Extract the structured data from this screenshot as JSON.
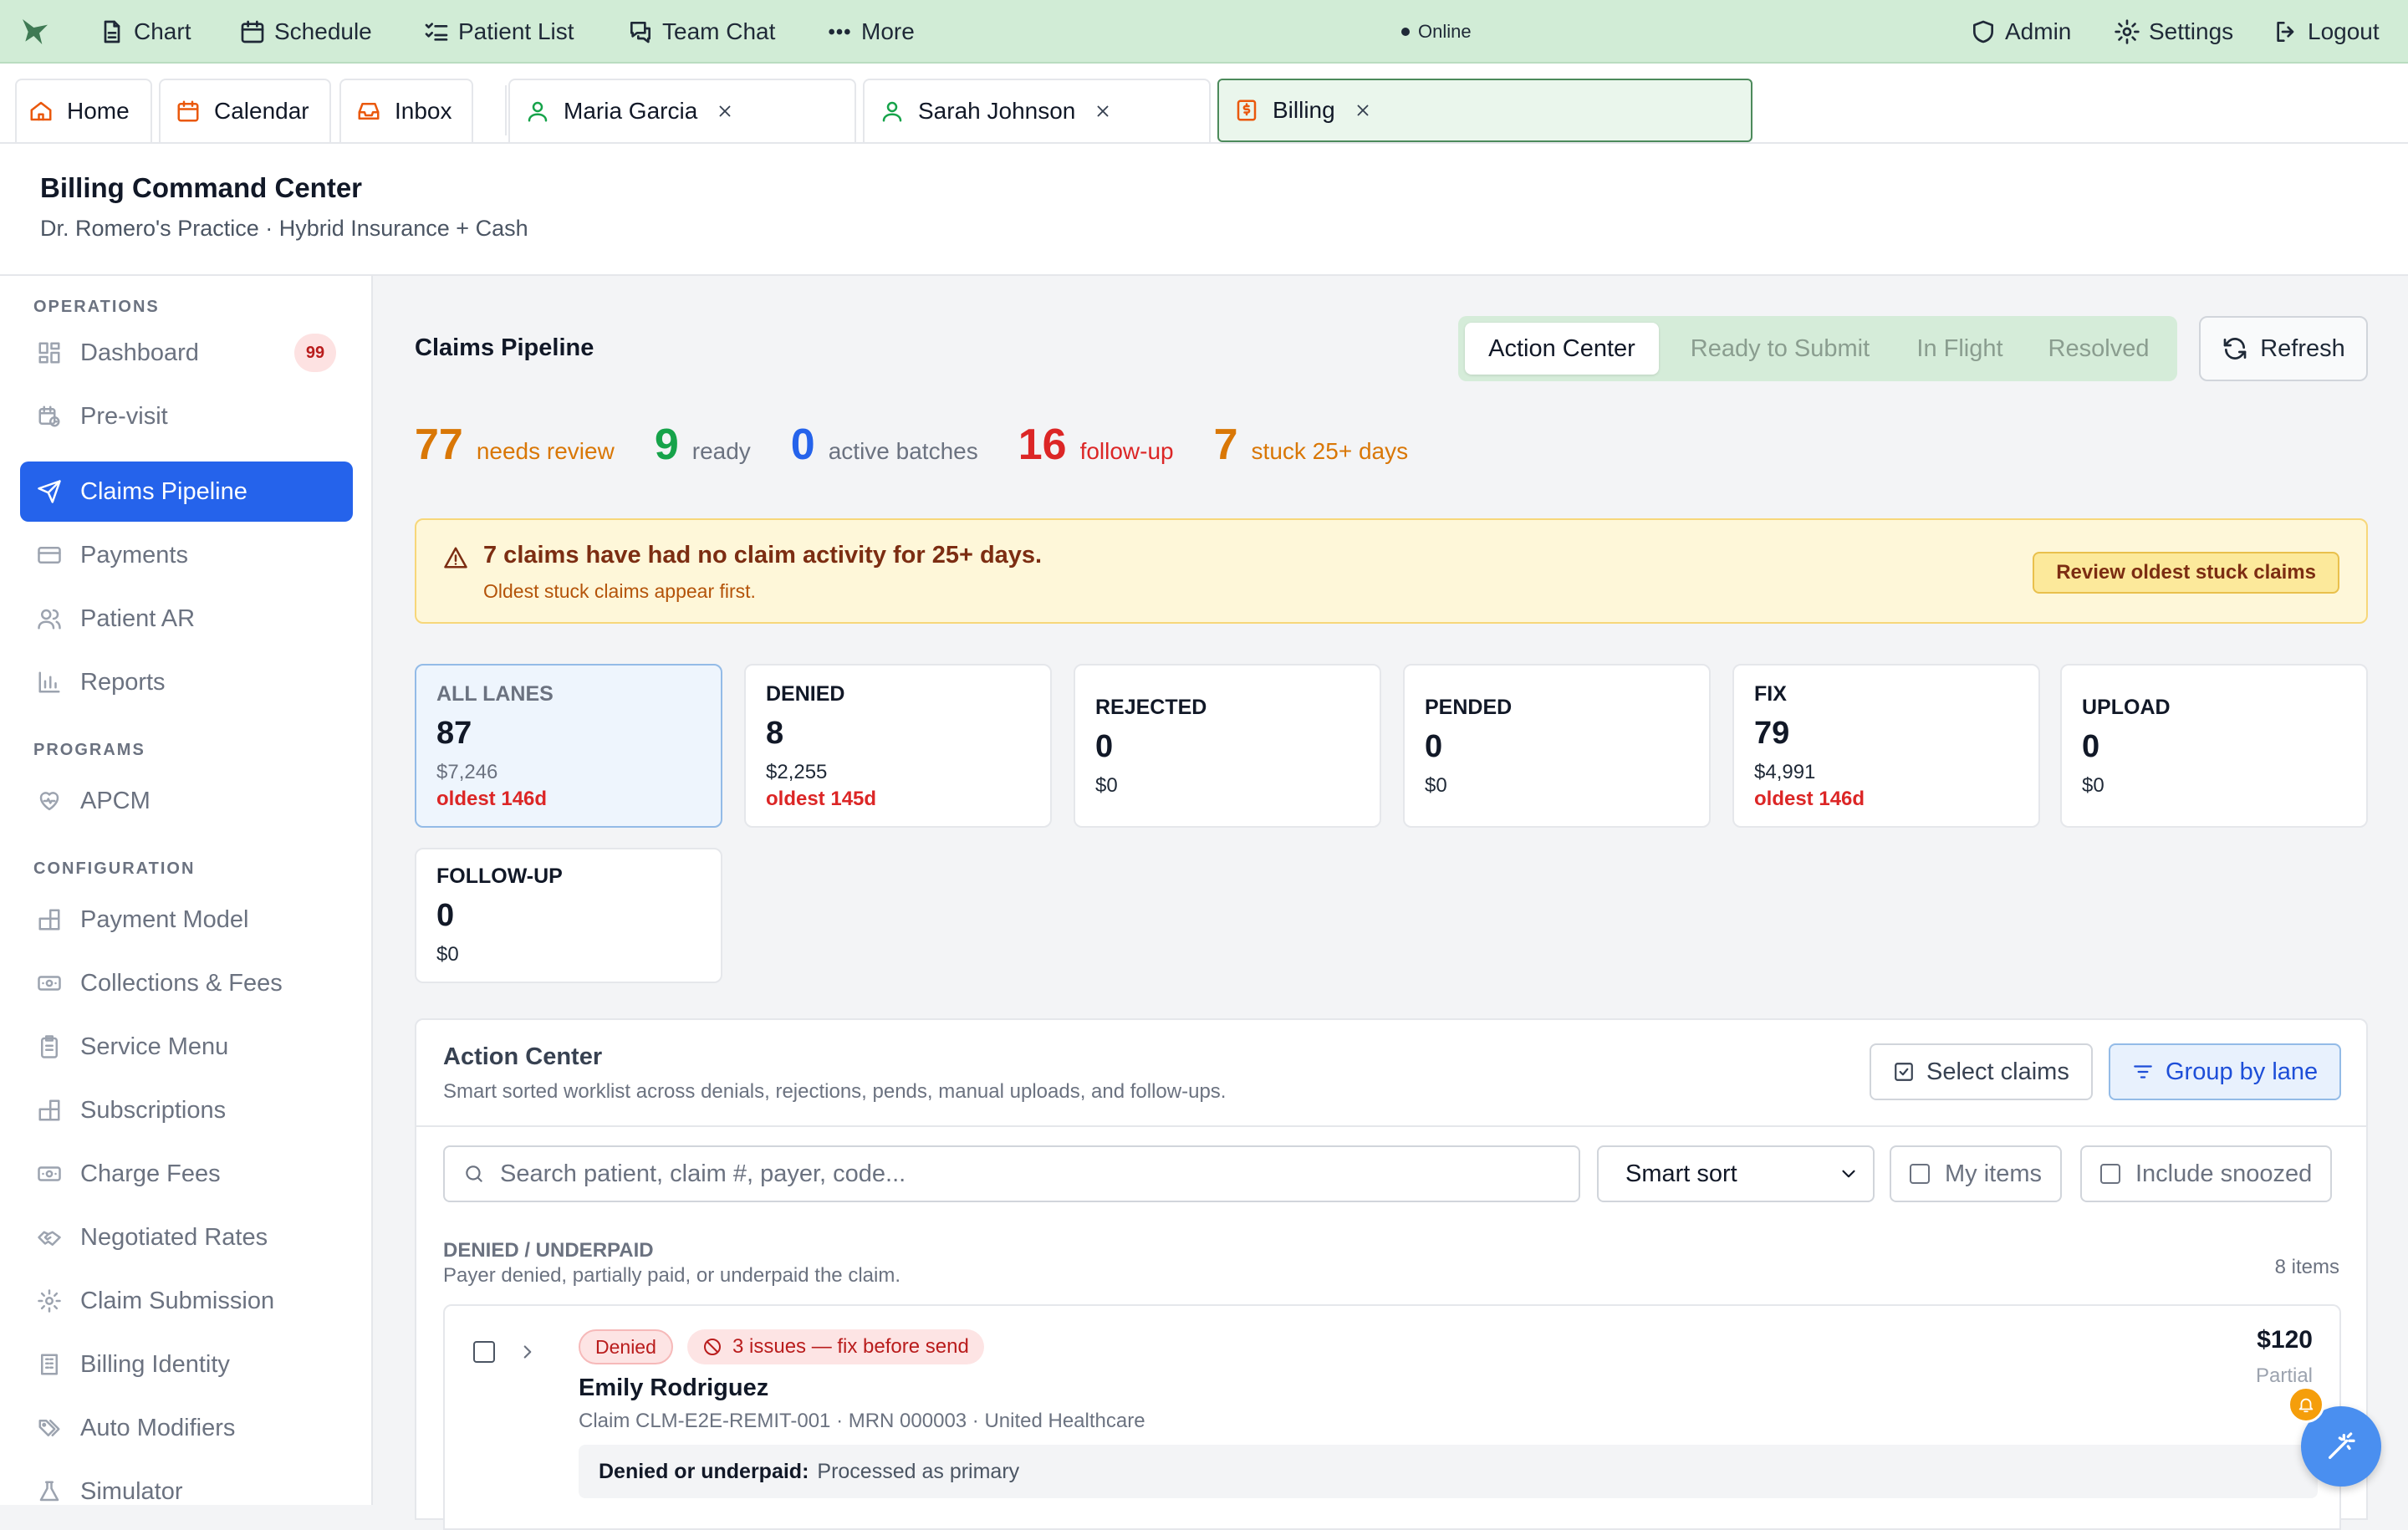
{
  "topbar": {
    "nav": [
      {
        "label": "Chart",
        "icon": "file-icon"
      },
      {
        "label": "Schedule",
        "icon": "calendar-icon"
      },
      {
        "label": "Patient List",
        "icon": "list-check-icon"
      },
      {
        "label": "Team Chat",
        "icon": "chat-icon"
      },
      {
        "label": "More",
        "icon": "ellipsis-icon"
      }
    ],
    "status": "Online",
    "right": [
      {
        "label": "Admin",
        "icon": "shield-icon"
      },
      {
        "label": "Settings",
        "icon": "gear-icon"
      },
      {
        "label": "Logout",
        "icon": "logout-icon"
      }
    ]
  },
  "tabs": {
    "fixed": [
      {
        "label": "Home",
        "icon": "home-icon"
      },
      {
        "label": "Calendar",
        "icon": "calendar-icon"
      },
      {
        "label": "Inbox",
        "icon": "inbox-icon"
      }
    ],
    "open": [
      {
        "label": "Maria Garcia",
        "icon": "user-icon"
      },
      {
        "label": "Sarah Johnson",
        "icon": "user-icon"
      },
      {
        "label": "Billing",
        "icon": "dollar-file-icon",
        "active": true
      }
    ]
  },
  "header": {
    "title": "Billing Command Center",
    "subtitle": "Dr. Romero's Practice · Hybrid Insurance + Cash"
  },
  "sidebar": {
    "sections": [
      {
        "label": "OPERATIONS"
      },
      {
        "label": "PROGRAMS"
      },
      {
        "label": "CONFIGURATION"
      }
    ],
    "items": [
      {
        "label": "Dashboard",
        "icon": "dashboard-icon",
        "badge": "99"
      },
      {
        "label": "Pre-visit",
        "icon": "calendar-clock-icon"
      },
      {
        "label": "Claims Pipeline",
        "icon": "send-icon",
        "active": true
      },
      {
        "label": "Payments",
        "icon": "credit-card-icon"
      },
      {
        "label": "Patient AR",
        "icon": "users-icon"
      },
      {
        "label": "Reports",
        "icon": "bar-chart-icon"
      },
      {
        "label": "APCM",
        "icon": "heart-pulse-icon"
      },
      {
        "label": "Payment Model",
        "icon": "blocks-icon"
      },
      {
        "label": "Collections & Fees",
        "icon": "banknote-icon"
      },
      {
        "label": "Service Menu",
        "icon": "clipboard-icon"
      },
      {
        "label": "Subscriptions",
        "icon": "blocks-icon"
      },
      {
        "label": "Charge Fees",
        "icon": "banknote-icon"
      },
      {
        "label": "Negotiated Rates",
        "icon": "handshake-icon"
      },
      {
        "label": "Claim Submission",
        "icon": "gear-icon"
      },
      {
        "label": "Billing Identity",
        "icon": "building-icon"
      },
      {
        "label": "Auto Modifiers",
        "icon": "tags-icon"
      },
      {
        "label": "Simulator",
        "icon": "flask-icon"
      }
    ]
  },
  "main": {
    "title": "Claims Pipeline",
    "view_tabs": [
      "Action Center",
      "Ready to Submit",
      "In Flight",
      "Resolved"
    ],
    "active_view": "Action Center",
    "refresh_label": "Refresh",
    "stats": [
      {
        "value": "77",
        "label": "needs review",
        "color": "#d97706"
      },
      {
        "value": "9",
        "label": "ready",
        "color": "#16a34a"
      },
      {
        "value": "0",
        "label": "active batches",
        "color": "#2563eb"
      },
      {
        "value": "16",
        "label": "follow-up",
        "color": "#dc2626"
      },
      {
        "value": "7",
        "label": "stuck 25+ days",
        "color": "#d97706"
      }
    ],
    "alert": {
      "title": "7 claims have had no claim activity for 25+ days.",
      "detail": "Oldest stuck claims appear first.",
      "action": "Review oldest stuck claims"
    },
    "lanes": [
      {
        "label": "ALL LANES",
        "count": "87",
        "amount": "$7,246",
        "oldest": "oldest 146d",
        "selected": true
      },
      {
        "label": "DENIED",
        "count": "8",
        "amount": "$2,255",
        "oldest": "oldest 145d"
      },
      {
        "label": "REJECTED",
        "count": "0",
        "amount": "$0"
      },
      {
        "label": "PENDED",
        "count": "0",
        "amount": "$0"
      },
      {
        "label": "FIX",
        "count": "79",
        "amount": "$4,991",
        "oldest": "oldest 146d"
      },
      {
        "label": "UPLOAD",
        "count": "0",
        "amount": "$0"
      },
      {
        "label": "FOLLOW-UP",
        "count": "0",
        "amount": "$0"
      }
    ],
    "action_center": {
      "title": "Action Center",
      "description": "Smart sorted worklist across denials, rejections, pends, manual uploads, and follow-ups.",
      "select_label": "Select claims",
      "group_label": "Group by lane",
      "search_placeholder": "Search patient, claim #, payer, code...",
      "sort_value": "Smart sort",
      "my_items_label": "My items",
      "snoozed_label": "Include snoozed",
      "group": {
        "title": "DENIED / UNDERPAID",
        "description": "Payer denied, partially paid, or underpaid the claim.",
        "count": "8 items"
      },
      "row": {
        "status": "Denied",
        "issues": "3 issues — fix before send",
        "patient": "Emily Rodriguez",
        "meta": "Claim CLM-E2E-REMIT-001 · MRN 000003 · United Healthcare",
        "amount": "$120",
        "state": "Partial",
        "reason_label": "Denied or underpaid:",
        "reason_text": "Processed as primary"
      }
    }
  }
}
